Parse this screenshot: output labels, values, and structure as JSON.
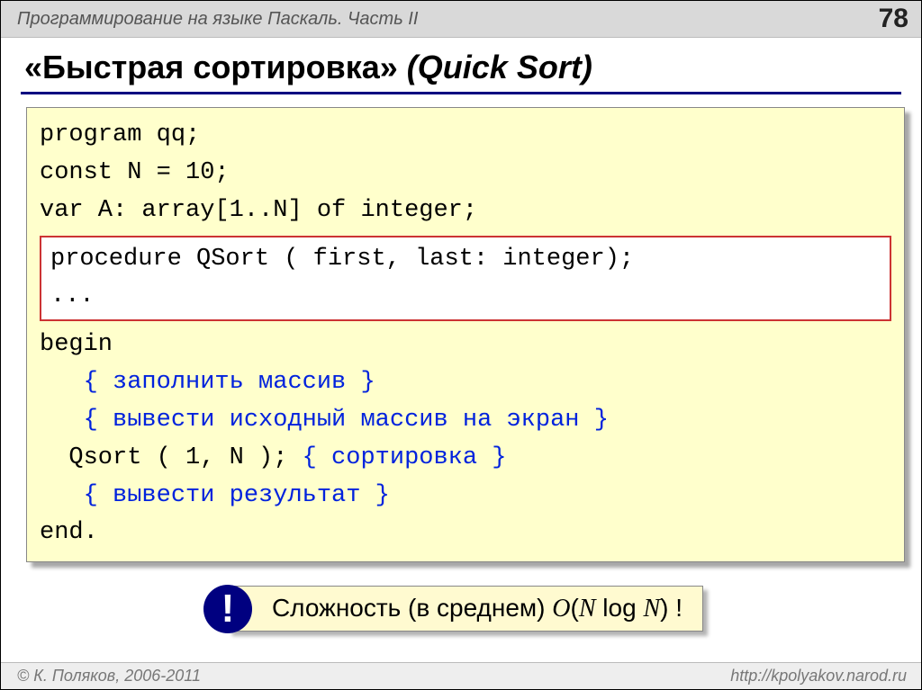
{
  "header": {
    "breadcrumb": "Программирование на языке Паскаль. Часть II",
    "page": "78"
  },
  "title": {
    "bold": "«Быстрая сортировка»",
    "italic": "(Quick Sort)"
  },
  "code": {
    "l1": "program qq;",
    "l2": "const N = 10;",
    "l3": "var A: array[1..N] of integer;",
    "boxed1": "procedure QSort ( first, last: integer);",
    "boxed2": "...",
    "l4": "begin",
    "c1": "   { заполнить массив }",
    "c2": "   { вывести исходный массив на экран }",
    "l5a": "  Qsort ( 1, N ); ",
    "l5b": "{ сортировка }",
    "c3": "   { вывести результат }",
    "l6": "end."
  },
  "complexity": {
    "circle": "!",
    "prefix": "Сложность (в среднем) ",
    "bigO_open": "O",
    "paren_open": "(",
    "N1": "N",
    "log": " log ",
    "N2": "N",
    "paren_close": ")",
    "bang": " !"
  },
  "footer": {
    "left": "© К. Поляков, 2006-2011",
    "right": "http://kpolyakov.narod.ru"
  }
}
